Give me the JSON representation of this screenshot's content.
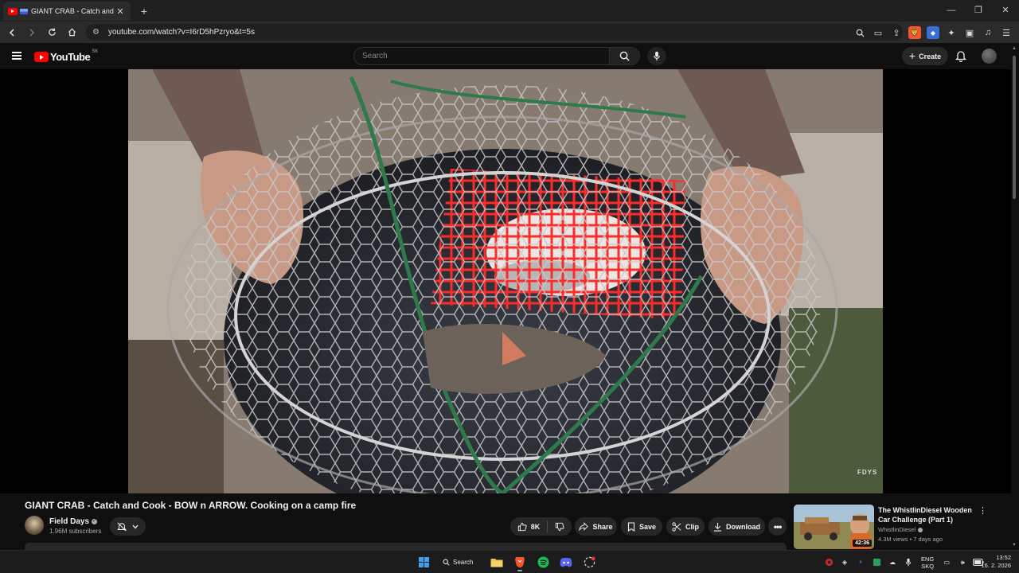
{
  "browser": {
    "tab_title": "GIANT CRAB - Catch and Co...",
    "url": "youtube.com/watch?v=I6rD5hPzryo&t=5s",
    "window_controls": [
      "minimize",
      "restore",
      "close"
    ]
  },
  "youtube": {
    "logo_text": "YouTube",
    "country_code": "SK",
    "search_placeholder": "Search",
    "create_label": "Create"
  },
  "video": {
    "watermark": "FDYS",
    "title": "GIANT CRAB - Catch and Cook - BOW n ARROW. Cooking on a camp fire",
    "channel_name": "Field Days",
    "subscribers": "1.96M subscribers",
    "likes": "8K",
    "share_label": "Share",
    "save_label": "Save",
    "clip_label": "Clip",
    "download_label": "Download"
  },
  "recommended": [
    {
      "title": "The WhistlinDiesel Wooden Car Challenge (Part 1)",
      "channel": "WhistlinDiesel",
      "meta": "4.3M views • 7 days ago",
      "duration": "42:36"
    }
  ],
  "taskbar": {
    "search_label": "Search",
    "lang_line1": "ENG",
    "lang_line2": "SKQ",
    "time": "13:52",
    "date": "16. 2. 2026"
  },
  "colors": {
    "background": "#0f0f0f",
    "youtube_red": "#ff0000",
    "pill": "#272727",
    "crab_net_red": "#ee2222"
  }
}
